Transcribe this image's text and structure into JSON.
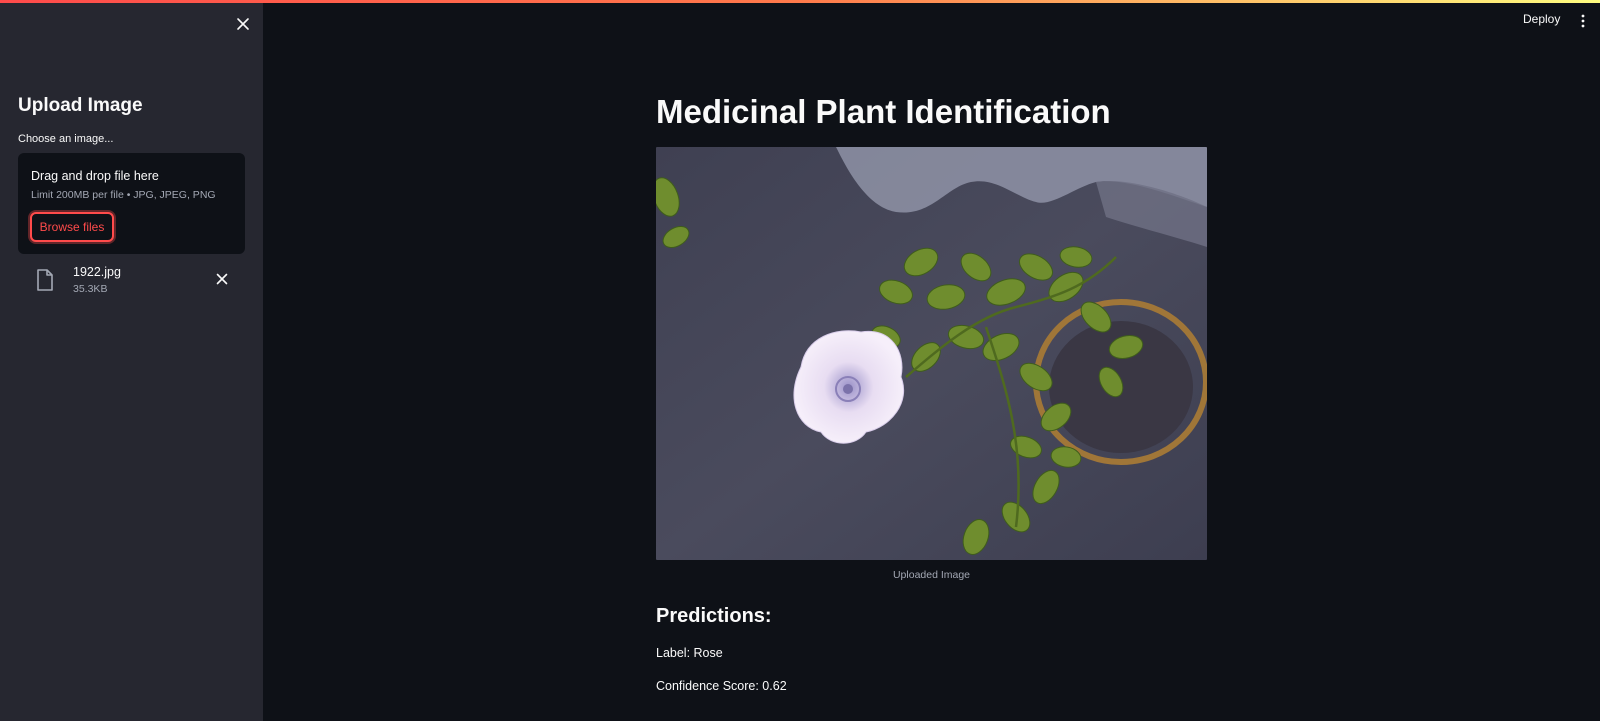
{
  "app": {
    "accent": "#ff4b4b",
    "background": "#0e1117",
    "sidebar_bg": "#262730"
  },
  "header": {
    "deploy_label": "Deploy",
    "menu_icon": "vertical-dots-icon"
  },
  "sidebar": {
    "close_icon": "close-icon",
    "title": "Upload Image",
    "uploader_label": "Choose an image...",
    "dropzone_title": "Drag and drop file here",
    "dropzone_limit": "Limit 200MB per file • JPG, JPEG, PNG",
    "browse_label": "Browse files",
    "file": {
      "name": "1922.jpg",
      "size": "35.3KB",
      "icon": "file-icon",
      "remove_icon": "close-icon"
    }
  },
  "main": {
    "title": "Medicinal Plant Identification",
    "image_caption": "Uploaded Image",
    "predictions_title": "Predictions:",
    "label_text": "Label: Rose",
    "confidence_text": "Confidence Score: 0.62"
  }
}
